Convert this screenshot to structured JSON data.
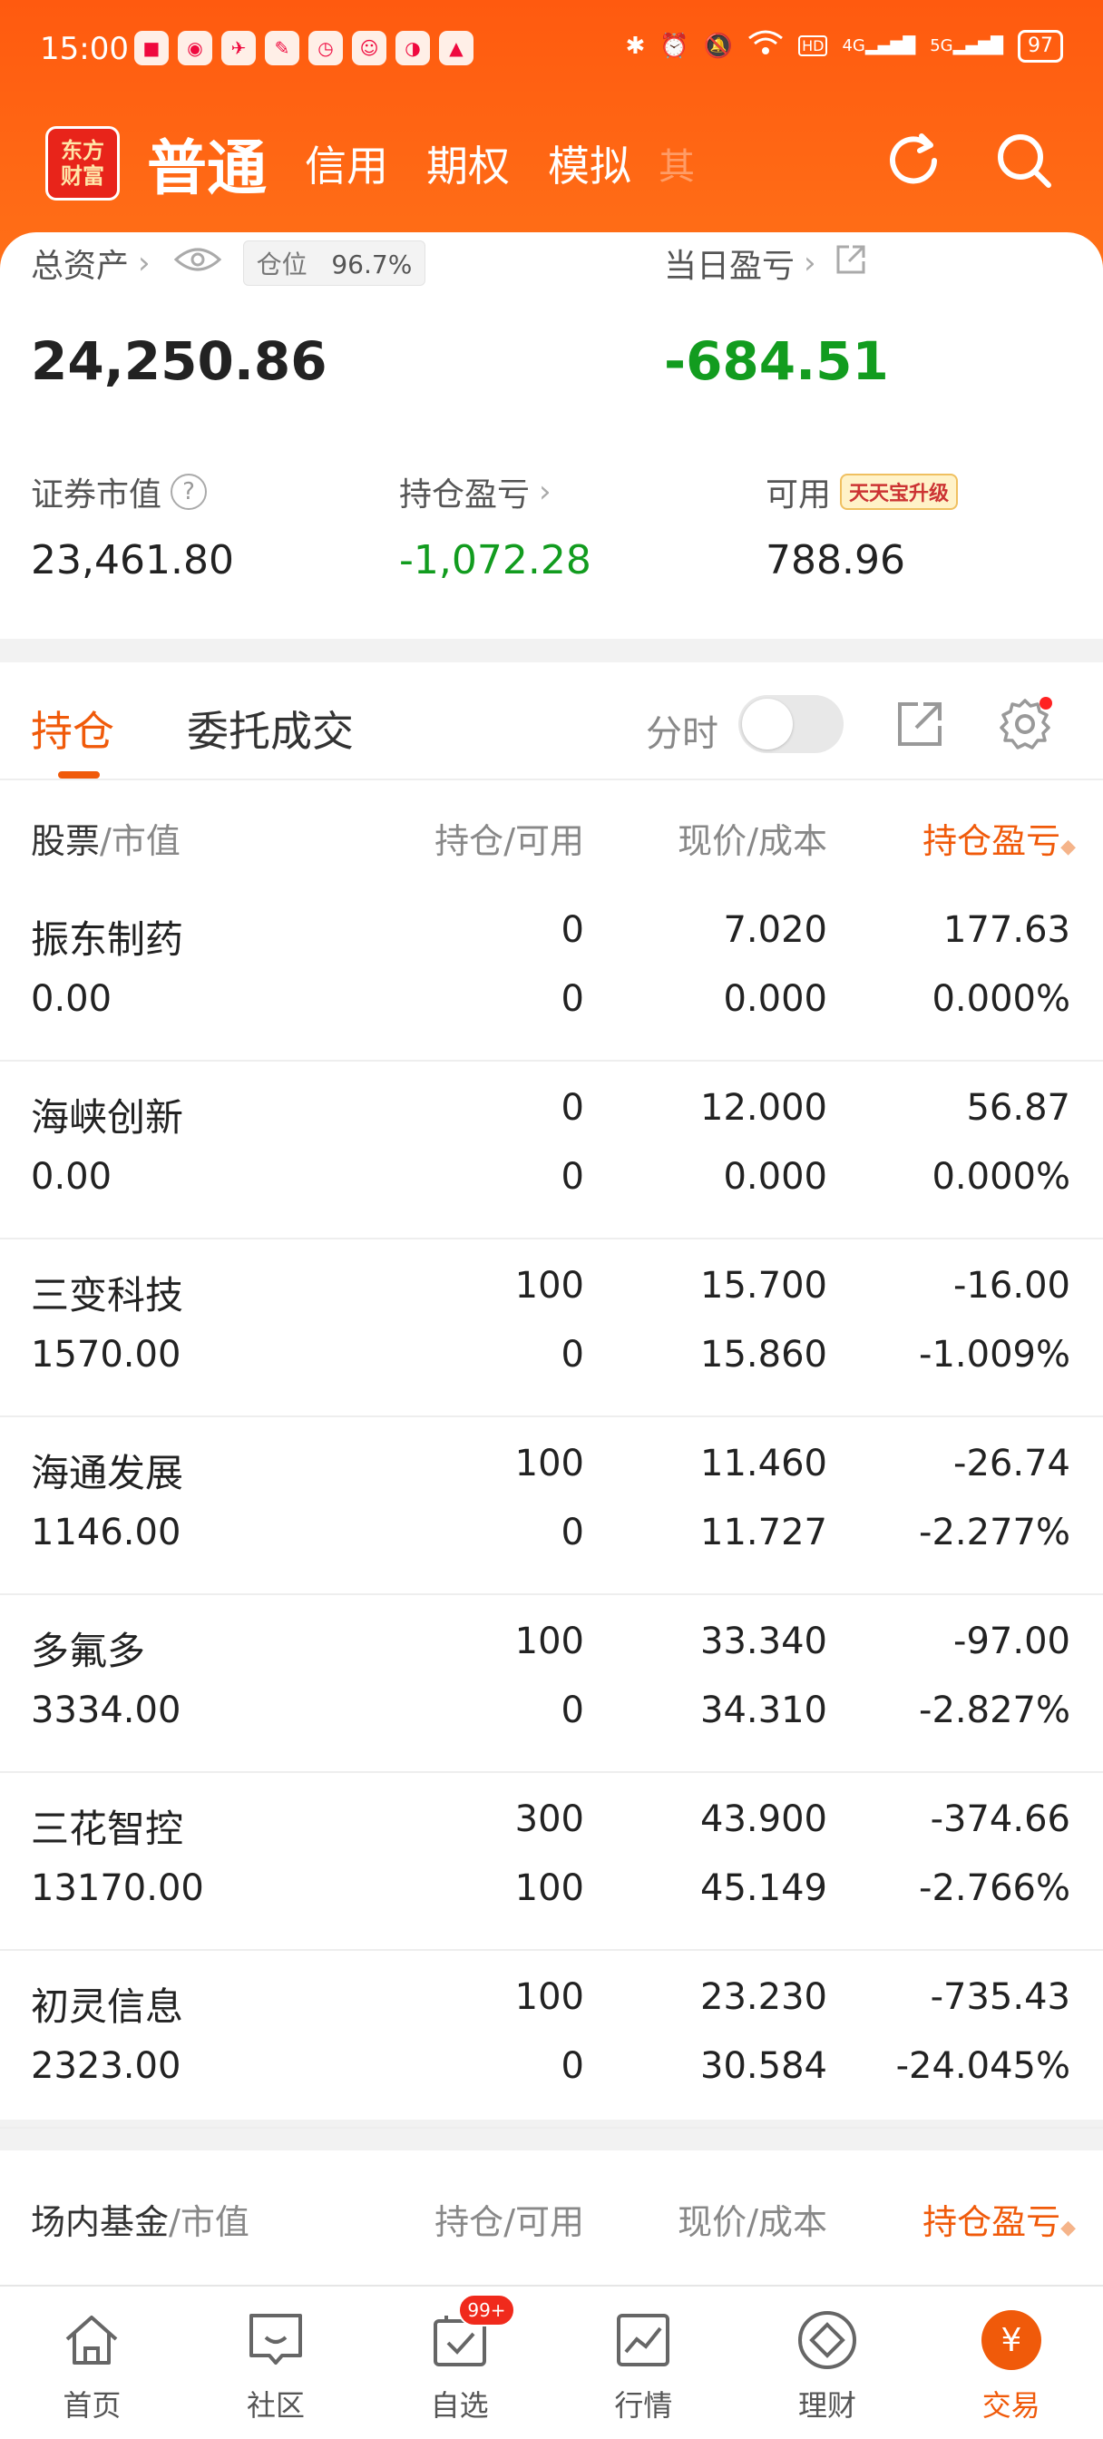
{
  "status_bar": {
    "time": "15:00",
    "battery": "97",
    "net1": "4G",
    "net2": "5G"
  },
  "nav": {
    "logo": "东方\n财富",
    "tabs": [
      {
        "label": "普通"
      },
      {
        "label": "信用"
      },
      {
        "label": "期权"
      },
      {
        "label": "模拟"
      },
      {
        "label": "其"
      }
    ]
  },
  "summary": {
    "total_assets_label": "总资产",
    "position_label": "仓位",
    "position_value": "96.7%",
    "daily_pl_label": "当日盈亏",
    "total_assets": "24,250.86",
    "daily_pl": "-684.51",
    "market_value_label": "证券市值",
    "market_value": "23,461.80",
    "holding_pl_label": "持仓盈亏",
    "holding_pl": "-1,072.28",
    "available_label": "可用",
    "available": "788.96",
    "tiantian_badge": "天天宝升级"
  },
  "holdings_tabs": {
    "tab1": "持仓",
    "tab2": "委托成交",
    "fenshi": "分时"
  },
  "table_header": {
    "stock": "股票",
    "market_value": "/市值",
    "hold": "持仓",
    "available": "/可用",
    "price": "现价",
    "cost": "/成本",
    "pl": "持仓盈亏"
  },
  "rows": [
    {
      "name": "振东制药",
      "mv": "0.00",
      "hold": "0",
      "avail": "0",
      "price": "7.020",
      "cost": "0.000",
      "pl": "177.63",
      "plpct": "0.000%",
      "dir": "up"
    },
    {
      "name": "海峡创新",
      "mv": "0.00",
      "hold": "0",
      "avail": "0",
      "price": "12.000",
      "cost": "0.000",
      "pl": "56.87",
      "plpct": "0.000%",
      "dir": "up"
    },
    {
      "name": "三变科技",
      "mv": "1570.00",
      "hold": "100",
      "avail": "0",
      "price": "15.700",
      "cost": "15.860",
      "pl": "-16.00",
      "plpct": "-1.009%",
      "dir": "down"
    },
    {
      "name": "海通发展",
      "mv": "1146.00",
      "hold": "100",
      "avail": "0",
      "price": "11.460",
      "cost": "11.727",
      "pl": "-26.74",
      "plpct": "-2.277%",
      "dir": "down"
    },
    {
      "name": "多氟多",
      "mv": "3334.00",
      "hold": "100",
      "avail": "0",
      "price": "33.340",
      "cost": "34.310",
      "pl": "-97.00",
      "plpct": "-2.827%",
      "dir": "down"
    },
    {
      "name": "三花智控",
      "mv": "13170.00",
      "hold": "300",
      "avail": "100",
      "price": "43.900",
      "cost": "45.149",
      "pl": "-374.66",
      "plpct": "-2.766%",
      "dir": "down"
    },
    {
      "name": "初灵信息",
      "mv": "2323.00",
      "hold": "100",
      "avail": "0",
      "price": "23.230",
      "cost": "30.584",
      "pl": "-735.43",
      "plpct": "-24.045%",
      "dir": "down"
    }
  ],
  "fund_header": {
    "title": "场内基金",
    "market_value": "/市值",
    "hold": "持仓",
    "available": "/可用",
    "price": "现价",
    "cost": "/成本",
    "pl": "持仓盈亏"
  },
  "bottom_nav": [
    {
      "label": "首页",
      "icon": "home-icon"
    },
    {
      "label": "社区",
      "icon": "community-icon"
    },
    {
      "label": "自选",
      "icon": "watchlist-icon",
      "badge": "99+"
    },
    {
      "label": "行情",
      "icon": "market-icon"
    },
    {
      "label": "理财",
      "icon": "wealth-icon"
    },
    {
      "label": "交易",
      "icon": "trade-icon"
    }
  ],
  "colors": {
    "accent": "#f05a0a",
    "up": "#e0201e",
    "down": "#129c1f"
  }
}
